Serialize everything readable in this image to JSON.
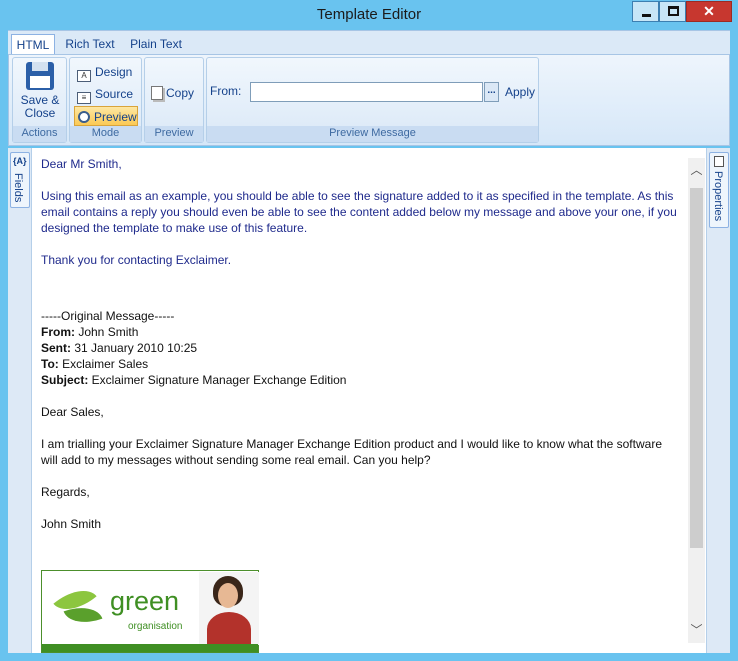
{
  "window": {
    "title": "Template Editor",
    "close_glyph": "✕"
  },
  "tabs": [
    {
      "label": "HTML",
      "active": true
    },
    {
      "label": "Rich Text",
      "active": false
    },
    {
      "label": "Plain Text",
      "active": false
    }
  ],
  "ribbon": {
    "actions": {
      "save_label_1": "Save &",
      "save_label_2": "Close",
      "group_label": "Actions"
    },
    "mode": {
      "design_label": "Design",
      "source_label": "Source",
      "preview_label": "Preview",
      "selected": "Preview",
      "group_label": "Mode"
    },
    "preview": {
      "copy_label": "Copy",
      "group_label": "Preview"
    },
    "preview_message": {
      "from_label": "From:",
      "from_value": "",
      "browse_label": "...",
      "apply_label": "Apply",
      "group_label": "Preview Message"
    }
  },
  "side_panels": {
    "left_label": "Fields",
    "left_icon": "{A}",
    "right_label": "Properties"
  },
  "message": {
    "greeting": "Dear Mr Smith,",
    "para1": "Using this email as an example, you should be able to see the signature added to it as specified in the template. As this email contains a reply you should even be able to see the content added below my message and above your one, if you designed the template to make use of this feature.",
    "thanks": "Thank you for contacting Exclaimer.",
    "original_header": "-----Original Message-----",
    "from_label": "From:",
    "from_value": " John Smith",
    "sent_label": "Sent:",
    "sent_value": " 31 January 2010 10:25",
    "to_label": "To:",
    "to_value": " Exclaimer Sales",
    "subject_label": "Subject:",
    "subject_value": " Exclaimer Signature Manager Exchange Edition",
    "greeting2": "Dear Sales,",
    "para2": "I am trialling your Exclaimer Signature Manager Exchange Edition product and I would like to know what the software will add to my messages without sending some real email. Can you help?",
    "regards": "Regards,",
    "signoff": "John Smith"
  },
  "signature": {
    "brand": "green",
    "tagline": "organisation"
  },
  "colors": {
    "titlebar": "#69c3ef",
    "message_text": "#1f2a8c",
    "brand_green": "#3f8f23",
    "selected_mode": "#fbc955"
  }
}
